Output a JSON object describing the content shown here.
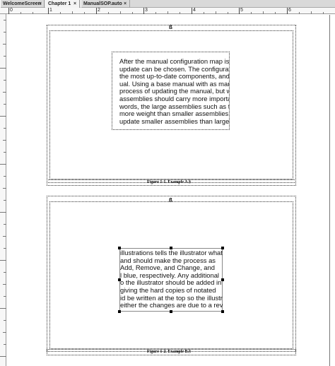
{
  "tabs": [
    {
      "label": "WelcomeScreen",
      "close": "×"
    },
    {
      "label": "Chapter 1",
      "close": "×"
    },
    {
      "label": "ManualSOP.auto",
      "close": "×"
    }
  ],
  "ruler": {
    "h_numbers": [
      "0",
      "1",
      "2",
      "3",
      "4",
      "5",
      "6"
    ]
  },
  "figures": [
    {
      "anchor_symbol": "ß",
      "text_lines": [
        "After the manual configuration map is",
        "update can be chosen. The configurat",
        "the most up-to-date components, and",
        "ual. Using a base manual with as mar",
        "process of updating the manual, but w",
        "assemblies should carry more importa",
        "words, the large assemblies such as th",
        "more weight than smaller assemblies",
        "update smaller assemblies than largei"
      ],
      "caption": "Figure 1-1. Example A.§"
    },
    {
      "anchor_symbol": "ß",
      "text_lines": [
        "illustrations tells the illustrator what",
        " and should make the process as",
        "Add, Remove, and Change, and",
        "l blue, respectively. Any additional",
        "o the illustrator should be added in",
        "giving the hard copies of notated",
        "id be written at the top so the illustra-",
        "either the changes are due to a rev"
      ],
      "caption": "Figure 1-2. Example B.§"
    }
  ]
}
